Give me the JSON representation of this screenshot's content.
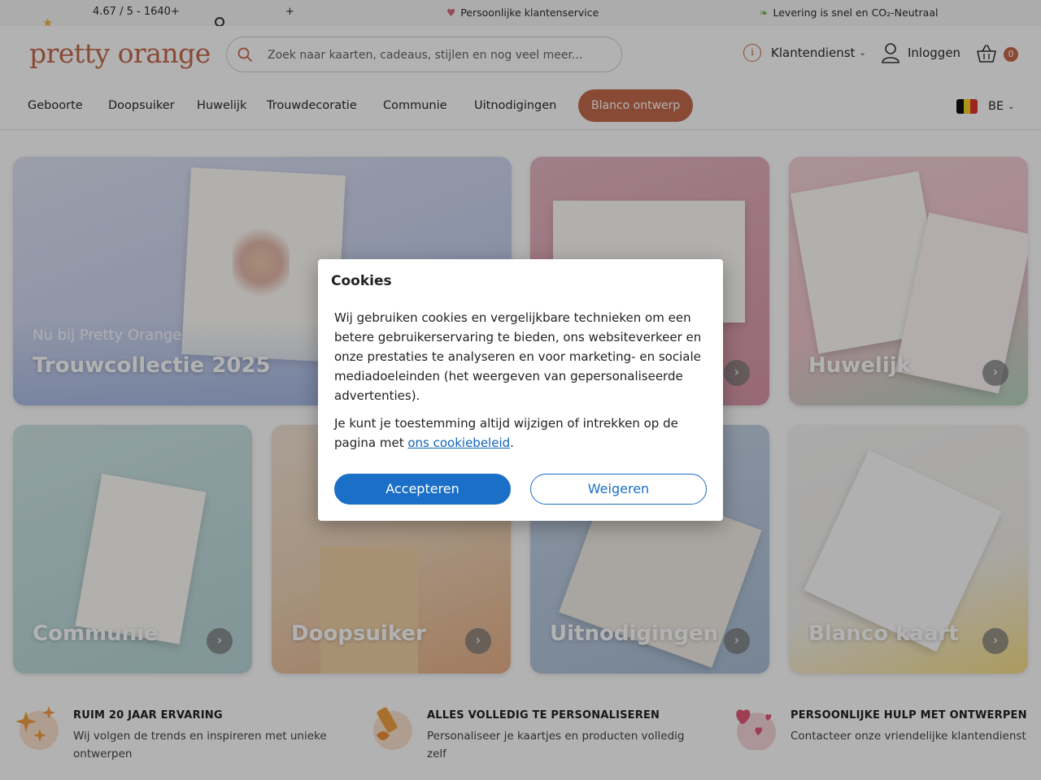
{
  "topbar": {
    "rating_text": "4.67 / 5 - 1640+",
    "rating_plus": "+",
    "usp_service": "Persoonlijke klantenservice",
    "usp_delivery": "Levering is snel en CO₂-Neutraal"
  },
  "header": {
    "logo": "pretty orange",
    "search_placeholder": "Zoek naar kaarten, cadeaus, stijlen en nog veel meer...",
    "service_label": "Klantendienst",
    "login_label": "Inloggen",
    "cart_count": "0"
  },
  "nav": {
    "items": [
      "Geboorte",
      "Doopsuiker",
      "Huwelijk",
      "Trouwdecoratie",
      "Communie",
      "Uitnodigingen"
    ],
    "cta": "Blanco ontwerp",
    "lang": "BE"
  },
  "tiles": [
    {
      "sub": "Nu bij Pretty Orange",
      "title": "Trouwcollectie 2025"
    },
    {
      "title": ""
    },
    {
      "title": "Huwelijk"
    },
    {
      "title": "Communie"
    },
    {
      "title": "Doopsuiker"
    },
    {
      "title": "Uitnodigingen"
    },
    {
      "title": "Blanco kaart"
    }
  ],
  "usps": [
    {
      "heading": "RUIM 20 JAAR ERVARING",
      "text": "Wij volgen de trends en inspireren met unieke ontwerpen"
    },
    {
      "heading": "ALLES VOLLEDIG TE PERSONALISEREN",
      "text": "Personaliseer je kaartjes en producten volledig zelf"
    },
    {
      "heading": "PERSOONLIJKE HULP MET ONTWERPEN",
      "text": "Contacteer onze vriendelijke klantendienst"
    }
  ],
  "cookie_modal": {
    "title": "Cookies",
    "paragraph1": "Wij gebruiken cookies en vergelijkbare technieken om een betere gebruikerservaring te bieden, ons websiteverkeer en onze prestaties te analyseren en voor marketing- en sociale mediadoeleinden (het weergeven van gepersonaliseerde advertenties).",
    "paragraph2_prefix": "Je kunt je toestemming altijd wijzigen of intrekken op de pagina met ",
    "paragraph2_link": "ons cookiebeleid",
    "paragraph2_suffix": ".",
    "accept": "Accepteren",
    "decline": "Weigeren"
  },
  "colors": {
    "brand": "#c46a4d",
    "primary_button": "#1b6fc6"
  }
}
